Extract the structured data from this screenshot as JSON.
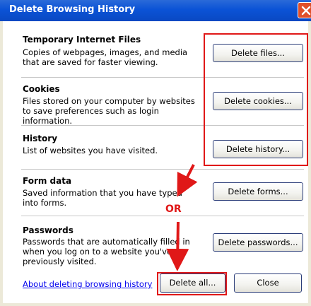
{
  "window": {
    "title": "Delete Browsing History"
  },
  "sections": [
    {
      "title": "Temporary Internet Files",
      "description": "Copies of webpages, images, and media that are saved for faster viewing.",
      "button": "Delete files..."
    },
    {
      "title": "Cookies",
      "description": "Files stored on your computer by websites to save preferences such as login information.",
      "button": "Delete cookies..."
    },
    {
      "title": "History",
      "description": "List of websites you have visited.",
      "button": "Delete history..."
    },
    {
      "title": "Form data",
      "description": "Saved information that you have typed into forms.",
      "button": "Delete forms..."
    },
    {
      "title": "Passwords",
      "description": "Passwords that are automatically filled in when you log on to a website you've previously visited.",
      "button": "Delete passwords..."
    }
  ],
  "footer": {
    "link": "About deleting browsing history",
    "delete_all": "Delete all...",
    "close": "Close"
  },
  "annotation": {
    "or_label": "OR",
    "color": "#e01818"
  },
  "colors": {
    "titlebar": "#0b53d6",
    "window_frame": "#ece9d8",
    "link": "#0000ee"
  },
  "icons": {
    "close": "close-icon"
  }
}
